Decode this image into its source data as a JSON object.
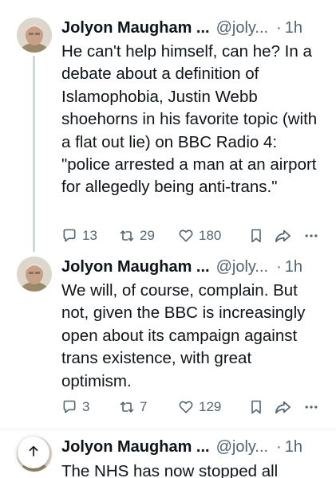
{
  "tweets": [
    {
      "author_name": "Jolyon Maugham ...",
      "handle": "@joly...",
      "separator": "·",
      "time": "1h",
      "text": "He can't help himself, can he? In a debate about a definition of Islamophobia, Justin Webb shoehorns in his favorite topic (with a flat out lie) on BBC Radio 4: \"police arrested a man at an airport for allegedly being anti-trans.\"",
      "replies": "13",
      "reposts": "29",
      "likes": "180"
    },
    {
      "author_name": "Jolyon Maugham ...",
      "handle": "@joly...",
      "separator": "·",
      "time": "1h",
      "text": "We will, of course, complain. But not, given the BBC is increasingly open about its campaign against trans existence, with great optimism.",
      "replies": "3",
      "reposts": "7",
      "likes": "129"
    },
    {
      "author_name": "Jolyon Maugham ...",
      "handle": "@joly...",
      "separator": "·",
      "time": "1h",
      "text": "The NHS has now stopped all"
    }
  ],
  "icons": {
    "reply": "reply-icon",
    "repost": "repost-icon",
    "like": "heart-icon",
    "bookmark": "bookmark-icon",
    "share": "share-icon",
    "more": "more-icon",
    "scroll_top": "arrow-up-icon"
  },
  "colors": {
    "text": "#0f1419",
    "secondary": "#536471",
    "thread_line": "#cfd9de"
  }
}
